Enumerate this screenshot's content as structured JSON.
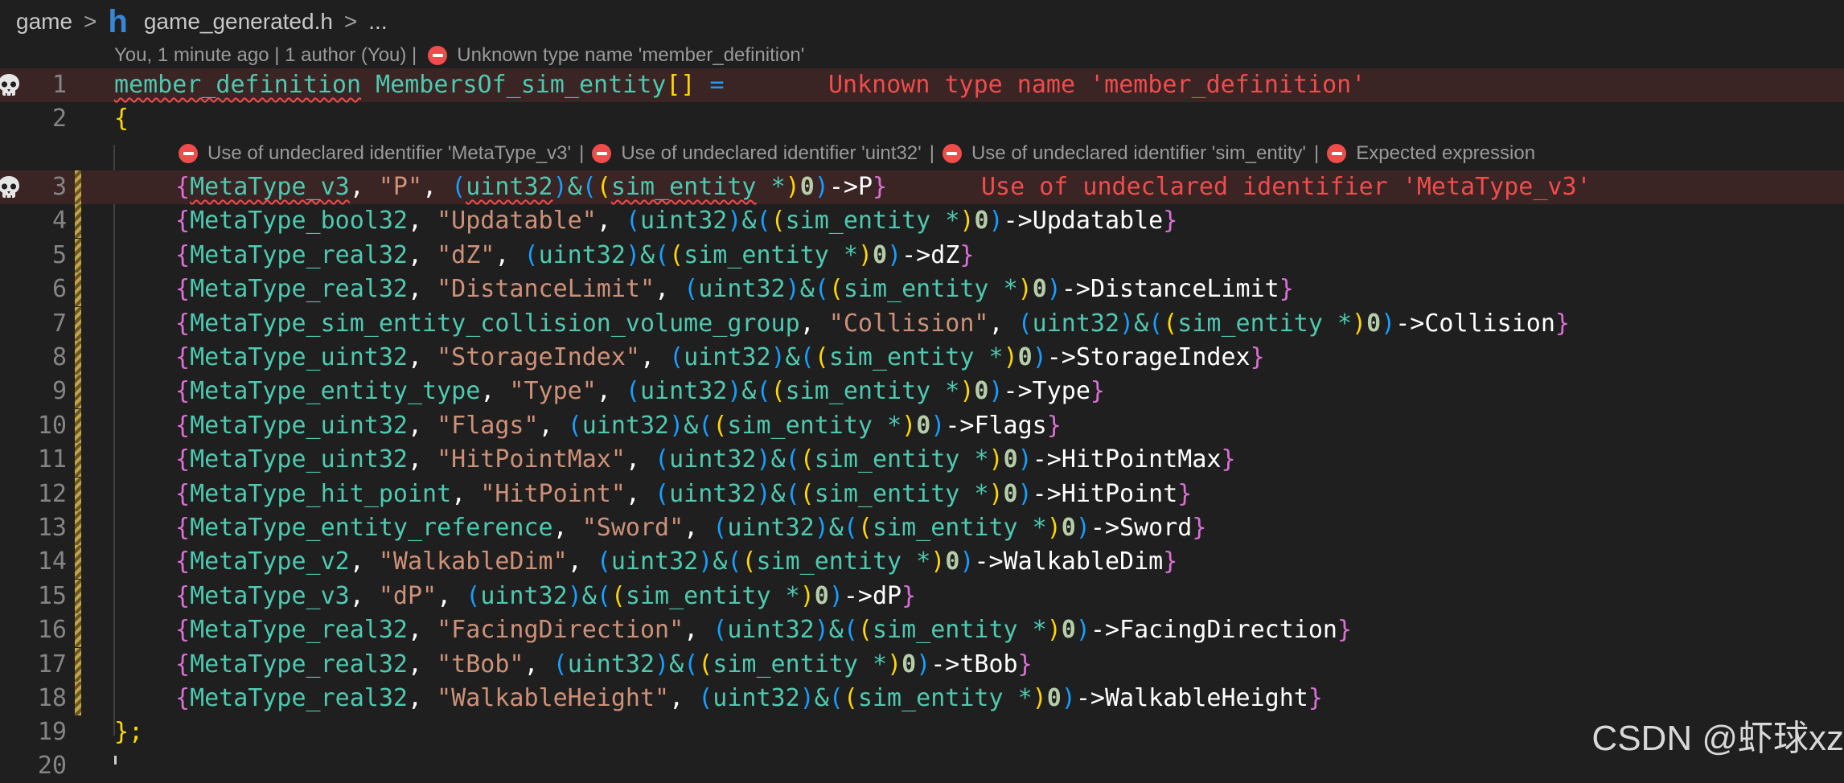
{
  "breadcrumb": {
    "folder": "game",
    "file_icon": "h",
    "file": "game_generated.h",
    "more": "..."
  },
  "blame": {
    "text": "You, 1 minute ago | 1 author (You) |",
    "error": "Unknown type name 'member_definition'"
  },
  "lens_errors": [
    "Use of undeclared identifier 'MetaType_v3'",
    "Use of undeclared identifier 'uint32'",
    "Use of undeclared identifier 'sim_entity'",
    "Expected expression"
  ],
  "lens_separator": "|",
  "line1": {
    "num": "1",
    "type": "member_definition",
    "name": "MembersOf_sim_entity",
    "brackets": "[]",
    "eq": "=",
    "inline_error": "Unknown type name 'member_definition'"
  },
  "line2": {
    "num": "2",
    "text": "{"
  },
  "members": [
    {
      "num": "3",
      "type": "MetaType_v3",
      "label": "\"P\"",
      "field": "P"
    },
    {
      "num": "4",
      "type": "MetaType_bool32",
      "label": "\"Updatable\"",
      "field": "Updatable"
    },
    {
      "num": "5",
      "type": "MetaType_real32",
      "label": "\"dZ\"",
      "field": "dZ"
    },
    {
      "num": "6",
      "type": "MetaType_real32",
      "label": "\"DistanceLimit\"",
      "field": "DistanceLimit"
    },
    {
      "num": "7",
      "type": "MetaType_sim_entity_collision_volume_group",
      "label": "\"Collision\"",
      "field": "Collision"
    },
    {
      "num": "8",
      "type": "MetaType_uint32",
      "label": "\"StorageIndex\"",
      "field": "StorageIndex"
    },
    {
      "num": "9",
      "type": "MetaType_entity_type",
      "label": "\"Type\"",
      "field": "Type"
    },
    {
      "num": "10",
      "type": "MetaType_uint32",
      "label": "\"Flags\"",
      "field": "Flags"
    },
    {
      "num": "11",
      "type": "MetaType_uint32",
      "label": "\"HitPointMax\"",
      "field": "HitPointMax"
    },
    {
      "num": "12",
      "type": "MetaType_hit_point",
      "label": "\"HitPoint\"",
      "field": "HitPoint"
    },
    {
      "num": "13",
      "type": "MetaType_entity_reference",
      "label": "\"Sword\"",
      "field": "Sword"
    },
    {
      "num": "14",
      "type": "MetaType_v2",
      "label": "\"WalkableDim\"",
      "field": "WalkableDim"
    },
    {
      "num": "15",
      "type": "MetaType_v3",
      "label": "\"dP\"",
      "field": "dP"
    },
    {
      "num": "16",
      "type": "MetaType_real32",
      "label": "\"FacingDirection\"",
      "field": "FacingDirection"
    },
    {
      "num": "17",
      "type": "MetaType_real32",
      "label": "\"tBob\"",
      "field": "tBob"
    },
    {
      "num": "18",
      "type": "MetaType_real32",
      "label": "\"WalkableHeight\"",
      "field": "WalkableHeight"
    }
  ],
  "member_tokens": {
    "cast_type": "uint32",
    "struct_type": "sim_entity",
    "star": "*",
    "zero": "0",
    "amp": "&",
    "arrow": "->",
    "comma": ", "
  },
  "line3_inline_error": "Use of undeclared identifier 'MetaType_v3'",
  "line19": {
    "num": "19",
    "text": "};"
  },
  "line20": {
    "num": "20"
  },
  "watermark": "CSDN @虾球xz",
  "colors": {
    "background": "#1f1f1f",
    "error": "#f14c4c",
    "type": "#4ec9b0",
    "string": "#ce9178",
    "bracket_gold": "#ffd700",
    "bracket_pink": "#da70d6",
    "bracket_blue": "#179fff"
  },
  "icons": {
    "gutter": "skull-icon",
    "diagnostic": "error-circle-icon",
    "breadcrumb_separator": "chevron-right-icon"
  }
}
